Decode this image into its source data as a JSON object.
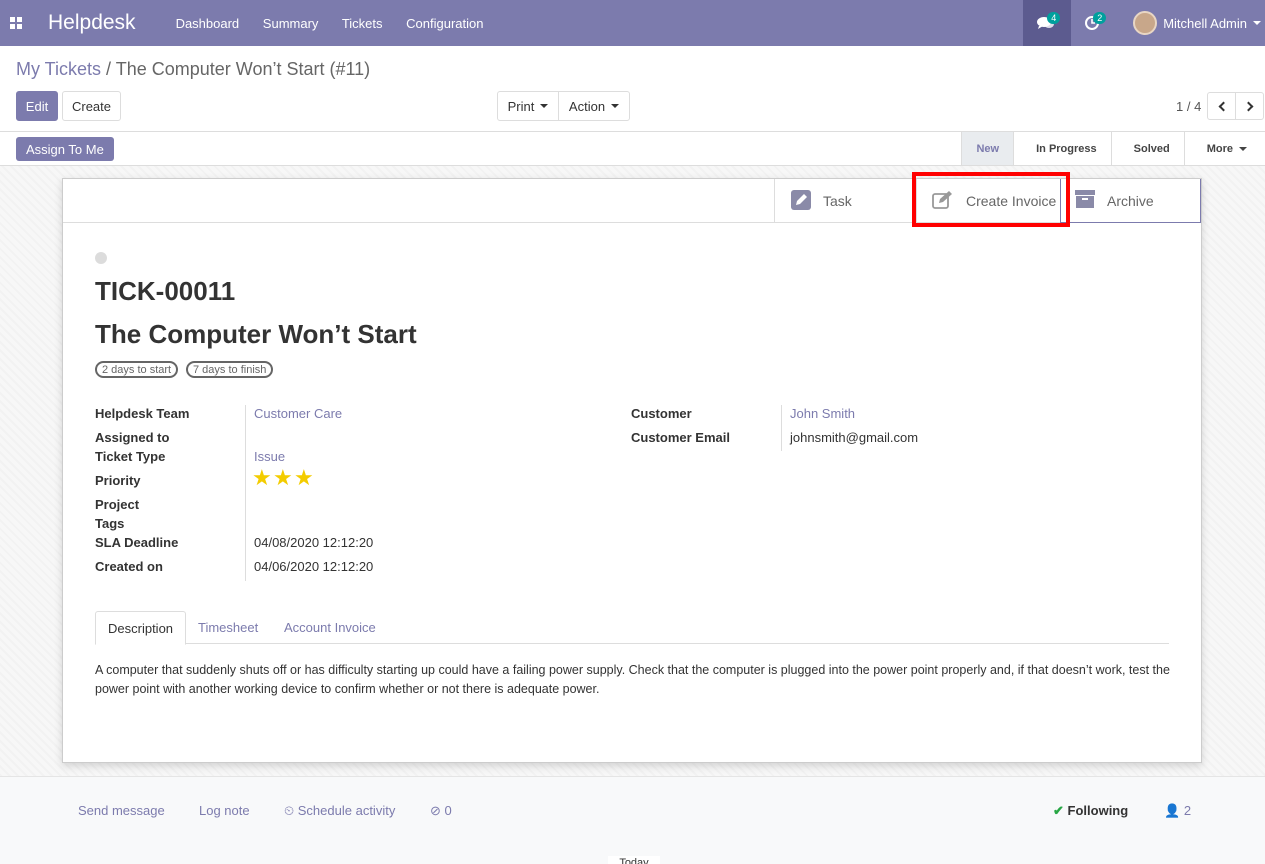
{
  "navbar": {
    "brand": "Helpdesk",
    "menu": [
      "Dashboard",
      "Summary",
      "Tickets",
      "Configuration"
    ],
    "messages_count": "4",
    "activities_count": "2",
    "user_name": "Mitchell Admin",
    "color": "#7c7bad"
  },
  "breadcrumb": {
    "parent": "My Tickets",
    "separator": "/",
    "current": "The Computer Won’t Start (#11)"
  },
  "toolbar": {
    "edit_label": "Edit",
    "create_label": "Create",
    "print_label": "Print",
    "action_label": "Action",
    "pager": "1 / 4"
  },
  "statusbar": {
    "assign_label": "Assign To Me",
    "stages": [
      "New",
      "In Progress",
      "Solved"
    ],
    "current_stage": "New",
    "more_label": "More"
  },
  "smart_buttons": {
    "task": "Task",
    "create_invoice": "Create Invoice",
    "archive": "Archive"
  },
  "ticket": {
    "number": "TICK-00011",
    "title": "The Computer Won’t Start",
    "tags": [
      "2 days to start",
      "7 days to finish"
    ],
    "priority_stars": 3
  },
  "fields_left": {
    "team_label": "Helpdesk Team",
    "team_value": "Customer Care",
    "assigned_label": "Assigned to",
    "type_label": "Ticket Type",
    "type_value": "Issue",
    "priority_label": "Priority",
    "project_label": "Project",
    "tags_label": "Tags",
    "sla_label": "SLA Deadline",
    "sla_value": "04/08/2020 12:12:20",
    "created_label": "Created on",
    "created_value": "04/06/2020 12:12:20"
  },
  "fields_right": {
    "customer_label": "Customer",
    "customer_value": "John Smith",
    "email_label": "Customer Email",
    "email_value": "johnsmith@gmail.com"
  },
  "tabs": [
    "Description",
    "Timesheet",
    "Account Invoice"
  ],
  "description": "A computer that suddenly shuts off or has difficulty starting up could have a failing power supply. Check that the computer is plugged into the power point properly and, if that doesn’t work, test the power point with another working device to confirm whether or not there is adequate power.",
  "chatter": {
    "send_message": "Send message",
    "log_note": "Log note",
    "schedule_activity": "Schedule activity",
    "attachments": "0",
    "following": "Following",
    "followers": "2",
    "bottom_label": "Today"
  }
}
